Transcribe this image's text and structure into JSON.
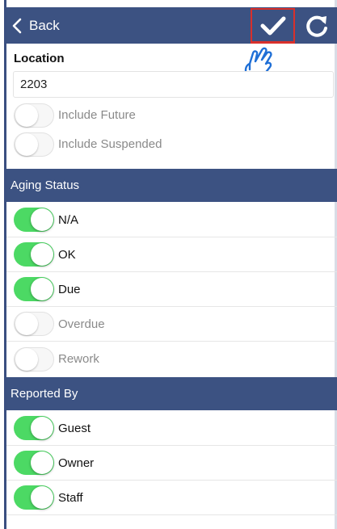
{
  "navbar": {
    "back_label": "Back",
    "bg_color": "#3c5282",
    "confirm_icon": "checkmark-icon",
    "refresh_icon": "refresh-icon"
  },
  "location": {
    "label": "Location",
    "value": "2203",
    "options": [
      {
        "label": "Include Future",
        "on": false
      },
      {
        "label": "Include Suspended",
        "on": false
      }
    ]
  },
  "aging_status": {
    "title": "Aging Status",
    "items": [
      {
        "label": "N/A",
        "on": true
      },
      {
        "label": "OK",
        "on": true
      },
      {
        "label": "Due",
        "on": true
      },
      {
        "label": "Overdue",
        "on": false
      },
      {
        "label": "Rework",
        "on": false
      }
    ]
  },
  "reported_by": {
    "title": "Reported By",
    "items": [
      {
        "label": "Guest",
        "on": true
      },
      {
        "label": "Owner",
        "on": true
      },
      {
        "label": "Staff",
        "on": true
      }
    ]
  },
  "colors": {
    "toggle_on": "#4cd964",
    "toggle_off": "#f7f7f7",
    "header": "#3c5282",
    "highlight": "#d9302b"
  }
}
